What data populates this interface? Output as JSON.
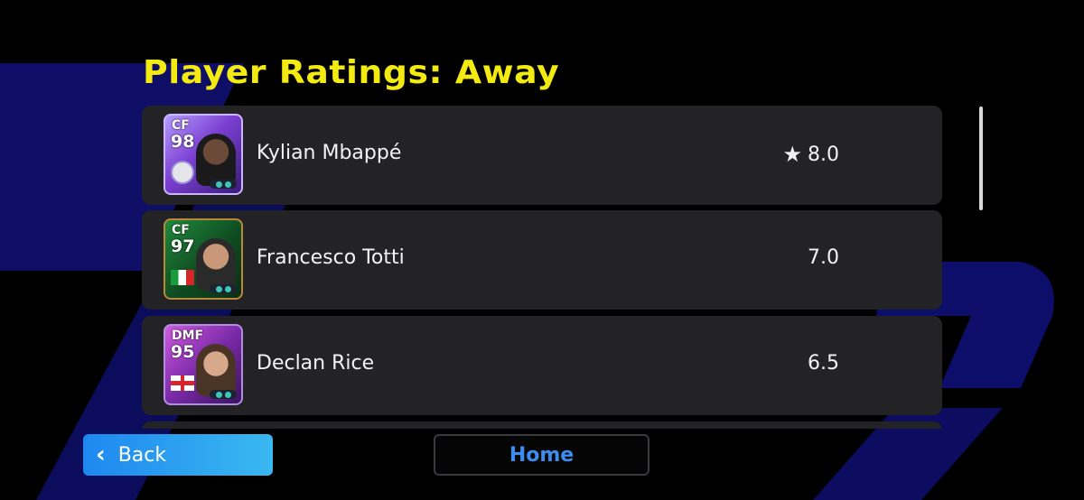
{
  "title": "Player Ratings: Away",
  "players": [
    {
      "position": "CF",
      "overall": "98",
      "name": "Kylian Mbappé",
      "rating": "8.0",
      "top_rated": true,
      "badge": "club-crest-icon"
    },
    {
      "position": "CF",
      "overall": "97",
      "name": "Francesco Totti",
      "rating": "7.0",
      "top_rated": false,
      "badge": "italy-flag-icon"
    },
    {
      "position": "DMF",
      "overall": "95",
      "name": "Declan Rice",
      "rating": "6.5",
      "top_rated": false,
      "badge": "england-flag-icon"
    }
  ],
  "buttons": {
    "back": "Back",
    "home": "Home"
  },
  "icons": {
    "star": "★",
    "back_chevron": "‹"
  },
  "colors": {
    "title": "#f2ea10",
    "accent": "#1e88f0",
    "home_text": "#3b8df0",
    "row_bg": "#232326"
  }
}
